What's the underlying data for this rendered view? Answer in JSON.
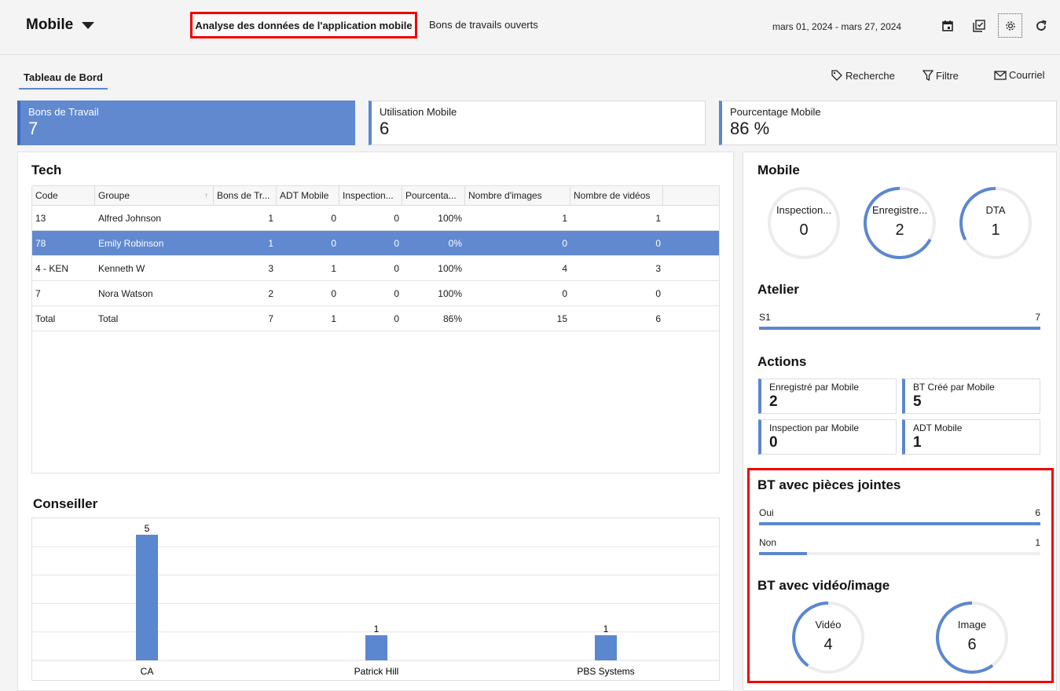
{
  "header": {
    "app_title": "Mobile",
    "tabs": [
      "Analyse des données de l'application mobile",
      "Bons de travails ouverts"
    ],
    "date_range": "mars 01, 2024 - mars 27, 2024",
    "icons": [
      "calendar-icon",
      "checklist-icon",
      "gear-icon",
      "refresh-icon"
    ]
  },
  "subnav": {
    "tab": "Tableau de Bord",
    "actions": {
      "recherche": "Recherche",
      "filtre": "Filtre",
      "courriel": "Courriel"
    }
  },
  "kpis": [
    {
      "label": "Bons de Travail",
      "value": "7"
    },
    {
      "label": "Utilisation Mobile",
      "value": "6"
    },
    {
      "label": "Pourcentage Mobile",
      "value": "86 %"
    }
  ],
  "tech": {
    "title": "Tech",
    "columns": [
      "Code",
      "Groupe",
      "Bons de Tr...",
      "ADT Mobile",
      "Inspection...",
      "Pourcenta...",
      "Nombre d'images",
      "Nombre de vidéos"
    ],
    "rows": [
      [
        "13",
        "Alfred Johnson",
        "1",
        "0",
        "0",
        "100%",
        "1",
        "1"
      ],
      [
        "78",
        "Emily Robinson",
        "1",
        "0",
        "0",
        "0%",
        "0",
        "0"
      ],
      [
        "4 - KEN",
        "Kenneth W",
        "3",
        "1",
        "0",
        "100%",
        "4",
        "3"
      ],
      [
        "7",
        "Nora Watson",
        "2",
        "0",
        "0",
        "100%",
        "0",
        "0"
      ],
      [
        "Total",
        "Total",
        "7",
        "1",
        "0",
        "86%",
        "15",
        "6"
      ]
    ],
    "selected_row": 1
  },
  "conseiller": {
    "title": "Conseiller"
  },
  "chart_data": {
    "type": "bar",
    "categories": [
      "CA",
      "Patrick Hill",
      "PBS Systems"
    ],
    "values": [
      5,
      1,
      1
    ],
    "title": "Conseiller",
    "xlabel": "",
    "ylabel": "",
    "ylim": [
      0,
      5
    ],
    "grid": true,
    "color": "#5b87cf"
  },
  "mobile": {
    "title": "Mobile",
    "rings": [
      {
        "label": "Inspection...",
        "value": "0",
        "fraction": 0
      },
      {
        "label": "Enregistre...",
        "value": "2",
        "fraction": 0.67
      },
      {
        "label": "DTA",
        "value": "1",
        "fraction": 0.33
      }
    ]
  },
  "atelier": {
    "title": "Atelier",
    "bars": [
      {
        "label": "S1",
        "value": "7",
        "fraction": 1.0
      }
    ]
  },
  "actions": {
    "title": "Actions",
    "cards": [
      {
        "label": "Enregistré par Mobile",
        "value": "2"
      },
      {
        "label": "BT Créé par Mobile",
        "value": "5"
      },
      {
        "label": "Inspection par Mobile",
        "value": "0"
      },
      {
        "label": "ADT Mobile",
        "value": "1"
      }
    ]
  },
  "pieces_jointes": {
    "title": "BT avec pièces jointes",
    "bars": [
      {
        "label": "Oui",
        "value": "6",
        "fraction": 1.0
      },
      {
        "label": "Non",
        "value": "1",
        "fraction": 0.17
      }
    ]
  },
  "video_image": {
    "title": "BT avec vidéo/image",
    "rings": [
      {
        "label": "Vidéo",
        "value": "4",
        "fraction": 0.4
      },
      {
        "label": "Image",
        "value": "6",
        "fraction": 0.6
      }
    ]
  },
  "colors": {
    "accent": "#5b87cf",
    "highlight": "#e00000"
  }
}
